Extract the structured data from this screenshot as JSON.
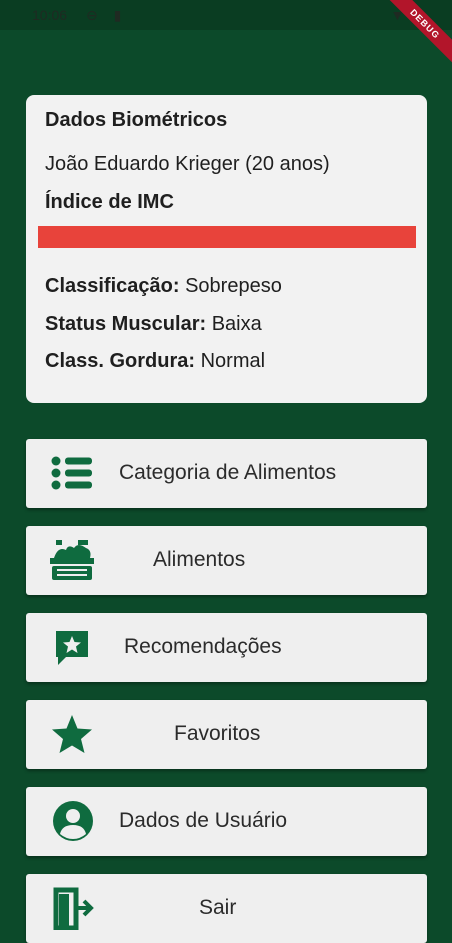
{
  "status_bar": {
    "time": "10:06",
    "debug_banner": "DEBUG"
  },
  "card": {
    "title": "Dados Biométricos",
    "user_line": "João Eduardo Krieger (20 anos)",
    "imc_title": "Índice de IMC",
    "imc_bar_color": "#e8433b",
    "rows": [
      {
        "label": "Classificação:",
        "value": "Sobrepeso"
      },
      {
        "label": "Status Muscular:",
        "value": "Baixa"
      },
      {
        "label": "Class. Gordura:",
        "value": "Normal"
      }
    ]
  },
  "menu": [
    {
      "label": "Categoria de Alimentos",
      "icon": "list-icon"
    },
    {
      "label": "Alimentos",
      "icon": "food-basket-icon"
    },
    {
      "label": "Recomendações",
      "icon": "recommend-icon"
    },
    {
      "label": "Favoritos",
      "icon": "star-icon"
    },
    {
      "label": "Dados de Usuário",
      "icon": "account-icon"
    },
    {
      "label": "Sair",
      "icon": "exit-icon"
    }
  ],
  "colors": {
    "background": "#0c4a2a",
    "accent": "#0f6b3f",
    "card": "#f2f2f2"
  }
}
